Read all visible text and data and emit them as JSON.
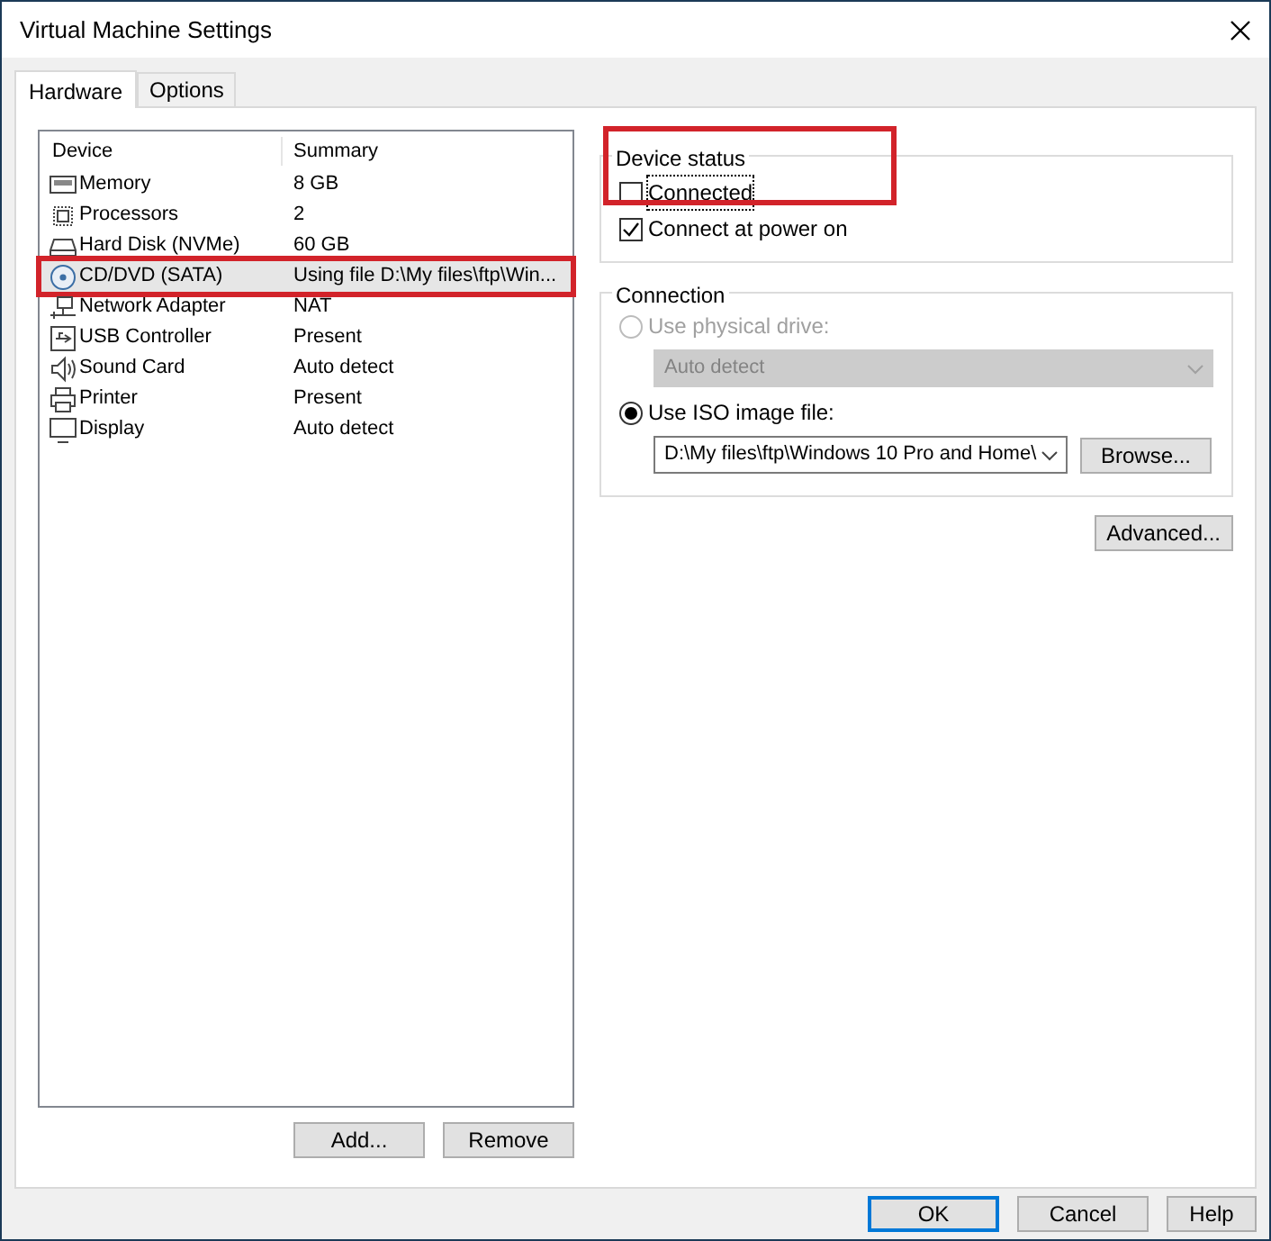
{
  "window": {
    "title": "Virtual Machine Settings"
  },
  "tabs": [
    {
      "label": "Hardware",
      "selected": true
    },
    {
      "label": "Options",
      "selected": false
    }
  ],
  "device_list": {
    "columns": [
      "Device",
      "Summary"
    ],
    "rows": [
      {
        "kind": "memory",
        "device": "Memory",
        "summary": "8 GB",
        "selected": false,
        "highlighted": false
      },
      {
        "kind": "processor",
        "device": "Processors",
        "summary": "2",
        "selected": false,
        "highlighted": false
      },
      {
        "kind": "disk",
        "device": "Hard Disk (NVMe)",
        "summary": "60 GB",
        "selected": false,
        "highlighted": false
      },
      {
        "kind": "cd",
        "device": "CD/DVD (SATA)",
        "summary": "Using file D:\\My files\\ftp\\Win...",
        "selected": true,
        "highlighted": true
      },
      {
        "kind": "network",
        "device": "Network Adapter",
        "summary": "NAT",
        "selected": false,
        "highlighted": false
      },
      {
        "kind": "usb",
        "device": "USB Controller",
        "summary": "Present",
        "selected": false,
        "highlighted": false
      },
      {
        "kind": "sound",
        "device": "Sound Card",
        "summary": "Auto detect",
        "selected": false,
        "highlighted": false
      },
      {
        "kind": "printer",
        "device": "Printer",
        "summary": "Present",
        "selected": false,
        "highlighted": false
      },
      {
        "kind": "display",
        "device": "Display",
        "summary": "Auto detect",
        "selected": false,
        "highlighted": false
      }
    ],
    "buttons": [
      "Add...",
      "Remove"
    ]
  },
  "device_status": {
    "title": "Device status",
    "highlighted": true,
    "options": [
      {
        "label": "Connected",
        "checked": false,
        "focused": true
      },
      {
        "label": "Connect at power on",
        "checked": true,
        "focused": false
      }
    ]
  },
  "connection": {
    "title": "Connection",
    "options": [
      {
        "label": "Use physical drive:",
        "selected": false,
        "disabled": true,
        "combo": {
          "value": "Auto detect",
          "disabled": true
        }
      },
      {
        "label": "Use ISO image file:",
        "selected": true,
        "disabled": false,
        "combo": {
          "value": "D:\\My files\\ftp\\Windows 10 Pro and Home\\",
          "disabled": false
        },
        "button": "Browse..."
      }
    ]
  },
  "advanced_button": "Advanced...",
  "dialog_buttons": [
    {
      "label": "OK",
      "default": true
    },
    {
      "label": "Cancel",
      "default": false
    },
    {
      "label": "Help",
      "default": false
    }
  ]
}
